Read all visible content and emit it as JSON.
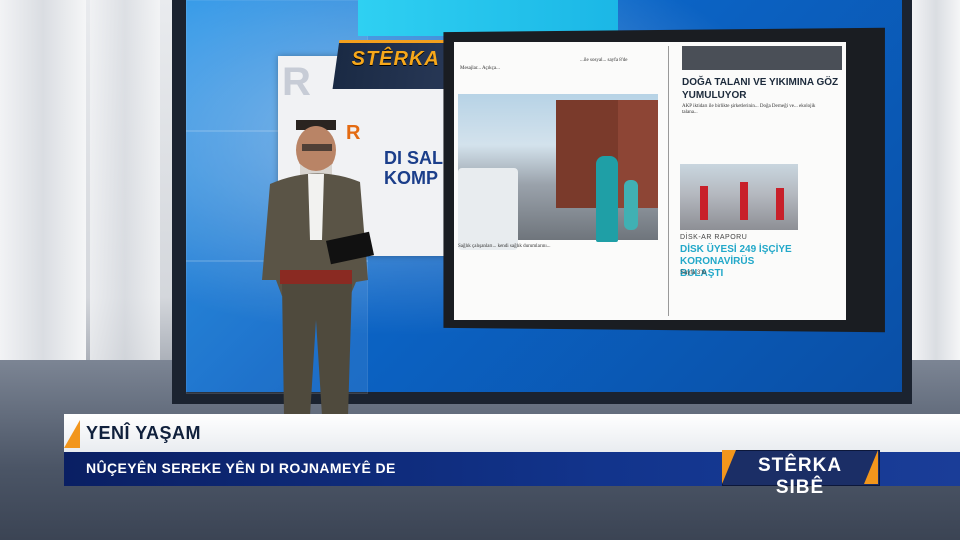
{
  "brand": {
    "name": "STÊRKA SIBÊ",
    "accent_color": "#f2961c",
    "navy_color": "#12348c"
  },
  "background_paper": {
    "line1": "R",
    "line2": "R",
    "line3": "DI SAL",
    "line4": "KOMP"
  },
  "newspaper": {
    "right_headline": "DOĞA TALANI VE YIKIMINA GÖZ YUMULUYOR",
    "right_body": "AKP iktidarı ile birlikte şirketlerinin... Doğa Derneği ve... ekolojik talana...",
    "disk_label": "DİSK-AR RAPORU",
    "disk_headline": "DİSK ÜYESİ 249 İŞÇİYE KORONAVİRÜS BULAŞTI",
    "page_ref": "Sayfa 3'te",
    "left_caption": "Sağlık çalışanları... kendi sağlık durumlarını...",
    "top_left_text": "Mesajlar... Açıkça...",
    "top_mid_text": "...ile sosyal... sayfa 8'de"
  },
  "lower_third": {
    "title": "YENÎ YAŞAM",
    "subtitle": "NÛÇEYÊN SEREKE YÊN DI ROJNAMEYÊ DE",
    "brand_label": "STÊRKA SIBÊ"
  }
}
